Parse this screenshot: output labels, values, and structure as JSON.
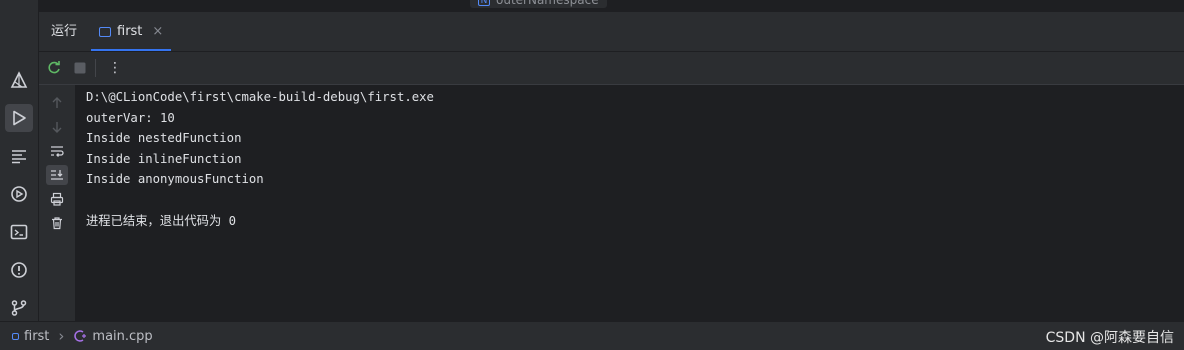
{
  "top_hint": {
    "text": "outerNamespace",
    "icon": "namespace-icon"
  },
  "run_panel": {
    "title": "运行",
    "tab": {
      "label": "first",
      "close_glyph": "×"
    }
  },
  "toolbar": {
    "rerun_icon": "rerun-icon",
    "stop_icon": "stop-icon",
    "more_glyph": "⋮"
  },
  "console": {
    "lines": [
      "D:\\@CLionCode\\first\\cmake-build-debug\\first.exe",
      "outerVar: 10",
      "Inside nestedFunction",
      "Inside inlineFunction",
      "Inside anonymousFunction",
      "",
      "进程已结束，退出代码为 0"
    ]
  },
  "statusbar": {
    "project": "first",
    "separator": "›",
    "file": "main.cpp"
  },
  "watermark": "CSDN @阿森要自信",
  "colors": {
    "accent": "#3574f0",
    "rerun": "#5fb865",
    "background": "#1e1f22",
    "panel": "#2b2d30"
  }
}
